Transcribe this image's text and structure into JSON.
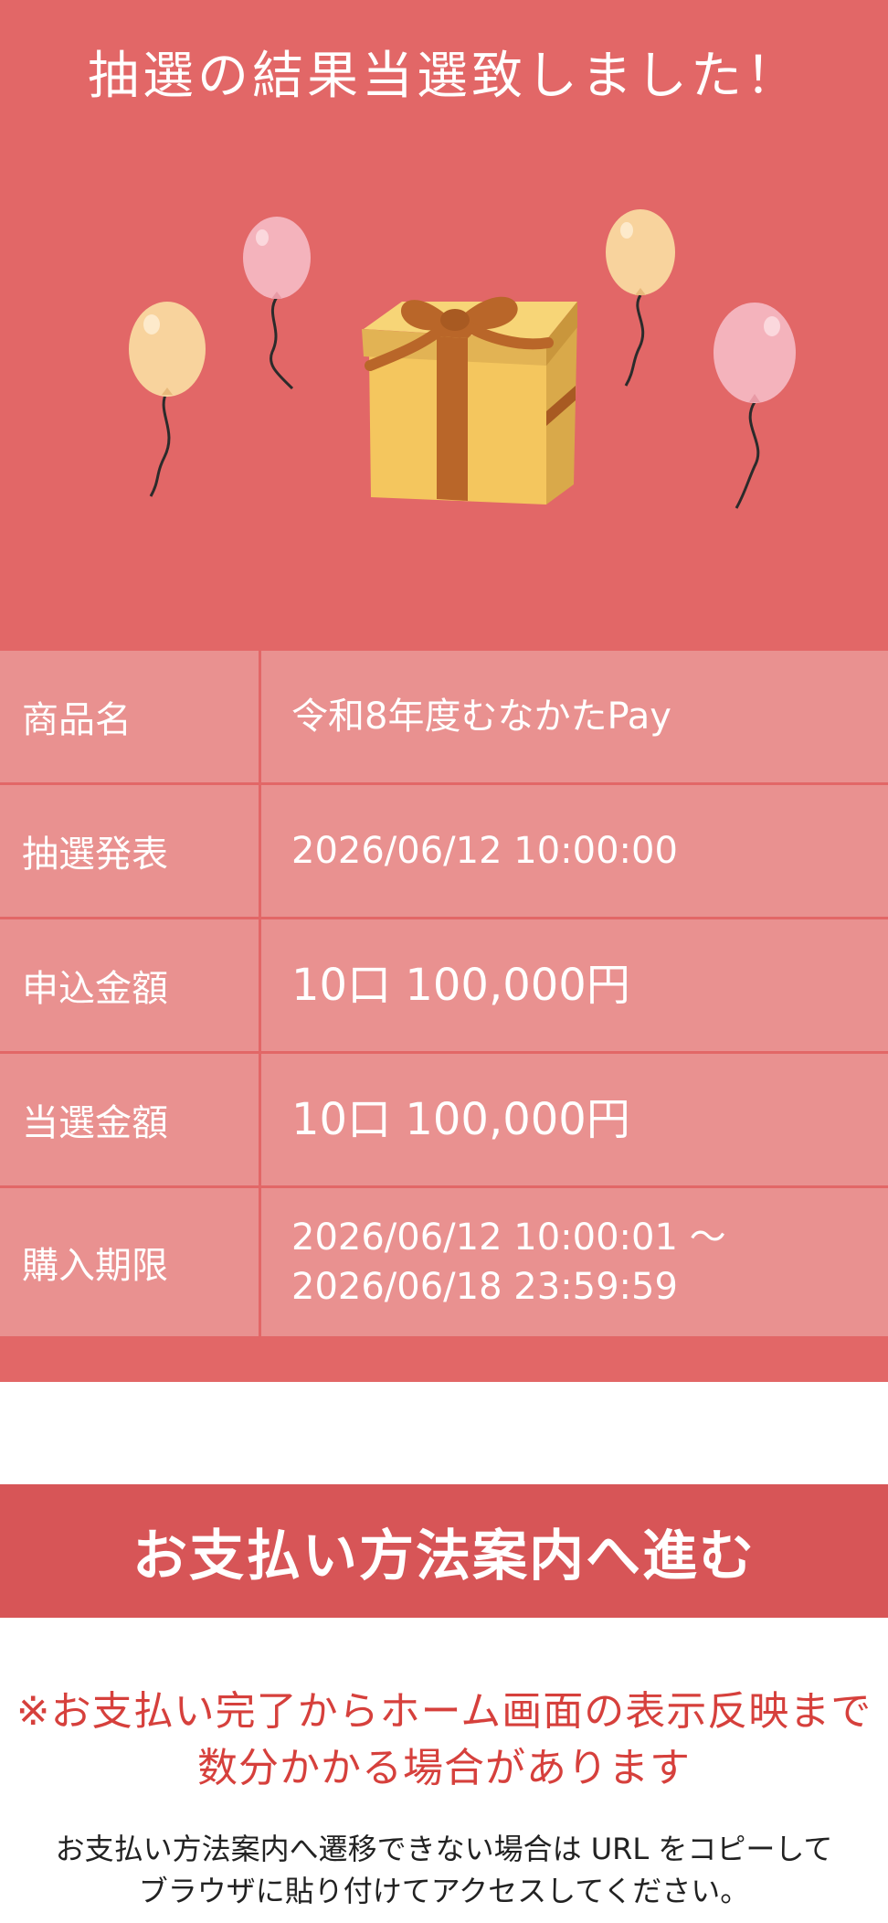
{
  "hero": {
    "title": "抽選の結果当選致しました！",
    "background_color": "#e26767",
    "illustration": {
      "icons": [
        "gift-box-icon",
        "balloon-orange-icon",
        "balloon-pink-icon"
      ]
    }
  },
  "details": {
    "rows": [
      {
        "label": "商品名",
        "value": "令和8年度むなかたPay"
      },
      {
        "label": "抽選発表",
        "value": "2026/06/12 10:00:00"
      },
      {
        "label": "申込金額",
        "value": "10口 100,000円"
      },
      {
        "label": "当選金額",
        "value": "10口 100,000円"
      },
      {
        "label": "購入期限",
        "value_line1": "2026/06/12 10:00:01 ～",
        "value_line2": "2026/06/18 23:59:59"
      }
    ]
  },
  "pay_button": {
    "label": "お支払い方法案内へ進む",
    "color": "#d75557"
  },
  "notice": {
    "line1": "※お支払い完了からホーム画面の表示反映まで",
    "line2": "数分かかる場合があります",
    "color": "#d6403c"
  },
  "help": {
    "line1": "お支払い方法案内へ遷移できない場合は URL をコピーして",
    "line2": "ブラウザに貼り付けてアクセスしてください。"
  }
}
